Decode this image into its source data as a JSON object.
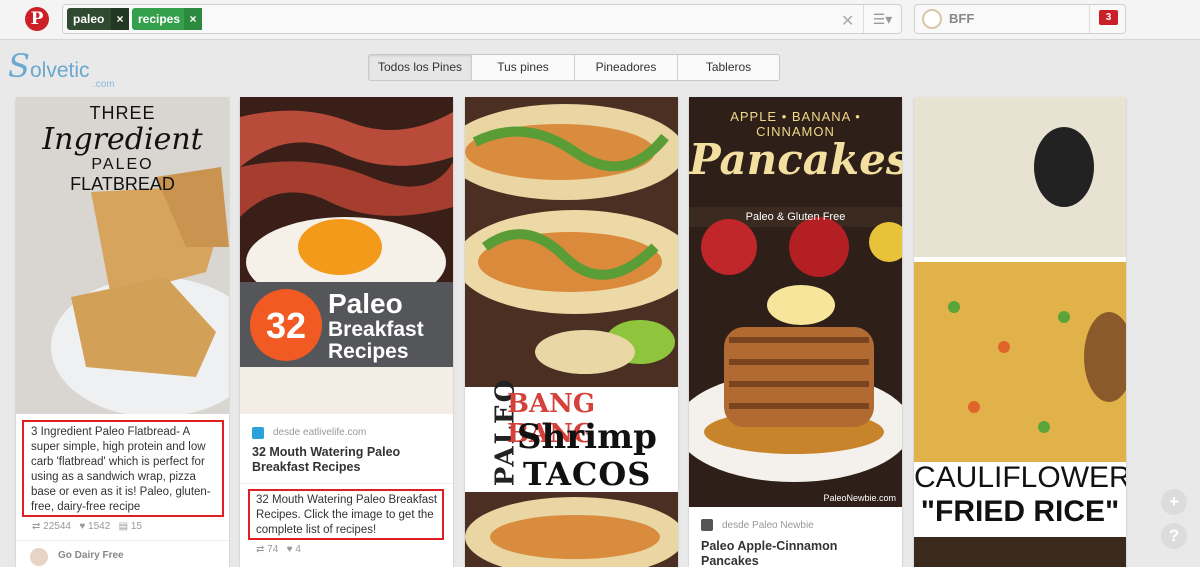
{
  "header": {
    "logo_glyph": "P",
    "search_tags": [
      {
        "label": "paleo",
        "remove": "×"
      },
      {
        "label": "recipes",
        "remove": "×"
      }
    ],
    "clear_glyph": "✕",
    "menu_glyph": "☰▾",
    "user_name": "BFF",
    "notification_count": "3"
  },
  "watermark": {
    "text1": "S",
    "text2": "olvetic",
    "text3": ".com"
  },
  "filter_tabs": [
    "Todos los Pines",
    "Tus pines",
    "Pineadores",
    "Tableros"
  ],
  "pins": [
    {
      "image_text": [
        "THREE",
        "Ingredient",
        "PALEO",
        "FLATBREAD"
      ],
      "description": "3 Ingredient Paleo Flatbread- A super simple, high protein and low carb 'flatbread' which is perfect for using as a sandwich wrap, pizza base or even as it is! Paleo, gluten-free, dairy-free recipe",
      "repins": "22544",
      "likes": "1542",
      "comments": "15",
      "pinner": "Go Dairy Free"
    },
    {
      "image_text": [
        "32",
        "Paleo",
        "Breakfast",
        "Recipes"
      ],
      "source": "desde eatlivelife.com",
      "title": "32 Mouth Watering Paleo Breakfast Recipes",
      "description": "32 Mouth Watering Paleo Breakfast Recipes. Click the image to get the complete list of recipes!",
      "repins": "74",
      "likes": "4"
    },
    {
      "image_text": [
        "PALEO",
        "BANG BANG",
        "Shrimp",
        "TACOS"
      ]
    },
    {
      "image_text": [
        "APPLE • BANANA • CINNAMON",
        "Pancakes",
        "Paleo & Gluten Free",
        "PaleoNewbie.com"
      ],
      "source": "desde Paleo Newbie",
      "title": "Paleo Apple-Cinnamon Pancakes"
    },
    {
      "image_text": [
        "CAULIFLOWER",
        "\"FRIED RICE\""
      ]
    }
  ],
  "floating_buttons": {
    "add": "+",
    "help": "?"
  },
  "colors": {
    "accent": "#cb2027",
    "tag_dark": "#2f4a31",
    "tag_green": "#35a04b",
    "highlight_box": "#e02020"
  }
}
